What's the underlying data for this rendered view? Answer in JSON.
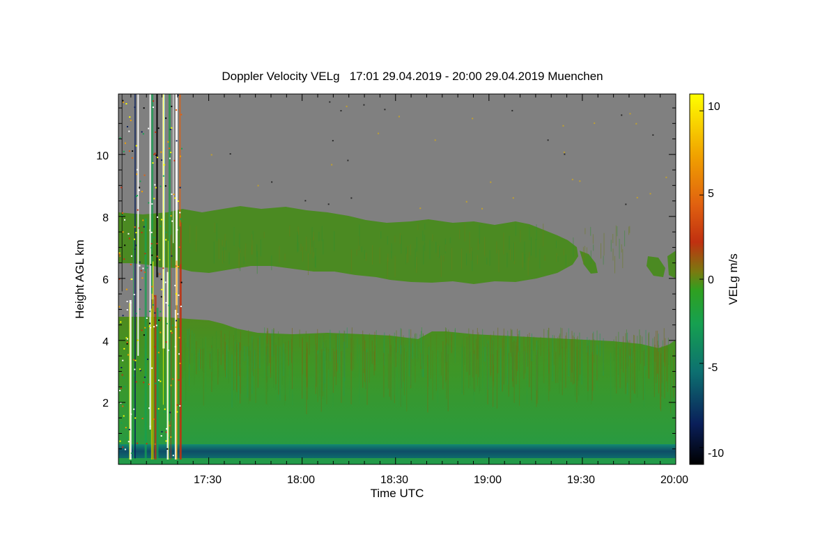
{
  "chart_data": {
    "type": "heatmap",
    "title": "Doppler Velocity VELg   17:01 29.04.2019 - 20:00 29.04.2019 Muenchen",
    "xlabel": "Time UTC",
    "ylabel": "Height AGL km",
    "colorbar_label": "VELg m/s",
    "x_range": [
      "17:01",
      "20:00"
    ],
    "x_ticks": [
      "17:30",
      "18:00",
      "18:30",
      "19:00",
      "19:30",
      "20:00"
    ],
    "y_range": [
      0,
      12
    ],
    "y_ticks": [
      2,
      4,
      6,
      8,
      10
    ],
    "colorbar_range": [
      -11,
      11
    ],
    "colorbar_ticks": [
      -10,
      -5,
      0,
      5,
      10
    ],
    "no_signal_color": "#808080",
    "colormap": [
      "#000000",
      "#0a1f5a",
      "#0d7070",
      "#16a050",
      "#2fa020",
      "#7a7a10",
      "#c03010",
      "#e06010",
      "#f0a000",
      "#ffff00"
    ],
    "layers": [
      {
        "name": "lower cloud/precip layer",
        "time_start": "17:01",
        "time_end": "20:00",
        "height_bottom_km": 0.2,
        "height_top_start_km": 4.7,
        "height_top_end_km": 3.7,
        "mean_velocity_ms": -2
      },
      {
        "name": "upper cloud layer",
        "time_start": "17:01",
        "time_end": "20:00",
        "height_bottom_km": 6.1,
        "height_top_km": 8.2,
        "mean_velocity_ms": -1
      },
      {
        "name": "near-surface layer",
        "height_bottom_km": 0.2,
        "height_top_km": 0.6,
        "mean_velocity_ms": -7
      }
    ]
  }
}
